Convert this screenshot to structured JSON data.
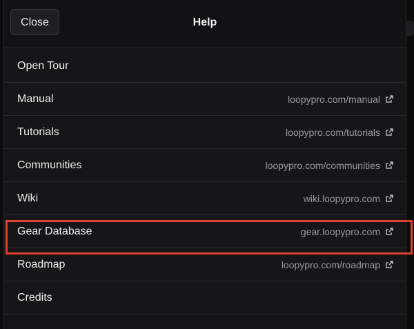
{
  "header": {
    "close_label": "Close",
    "title": "Help"
  },
  "items": [
    {
      "label": "Open Tour",
      "url": ""
    },
    {
      "label": "Manual",
      "url": "loopypro.com/manual"
    },
    {
      "label": "Tutorials",
      "url": "loopypro.com/tutorials"
    },
    {
      "label": "Communities",
      "url": "loopypro.com/communities"
    },
    {
      "label": "Wiki",
      "url": "wiki.loopypro.com"
    },
    {
      "label": "Gear Database",
      "url": "gear.loopypro.com"
    },
    {
      "label": "Roadmap",
      "url": "loopypro.com/roadmap"
    },
    {
      "label": "Credits",
      "url": ""
    }
  ],
  "highlight": {
    "item": "Gear Database",
    "color": "#e0402f"
  },
  "icons": {
    "external": "external-link-icon"
  }
}
